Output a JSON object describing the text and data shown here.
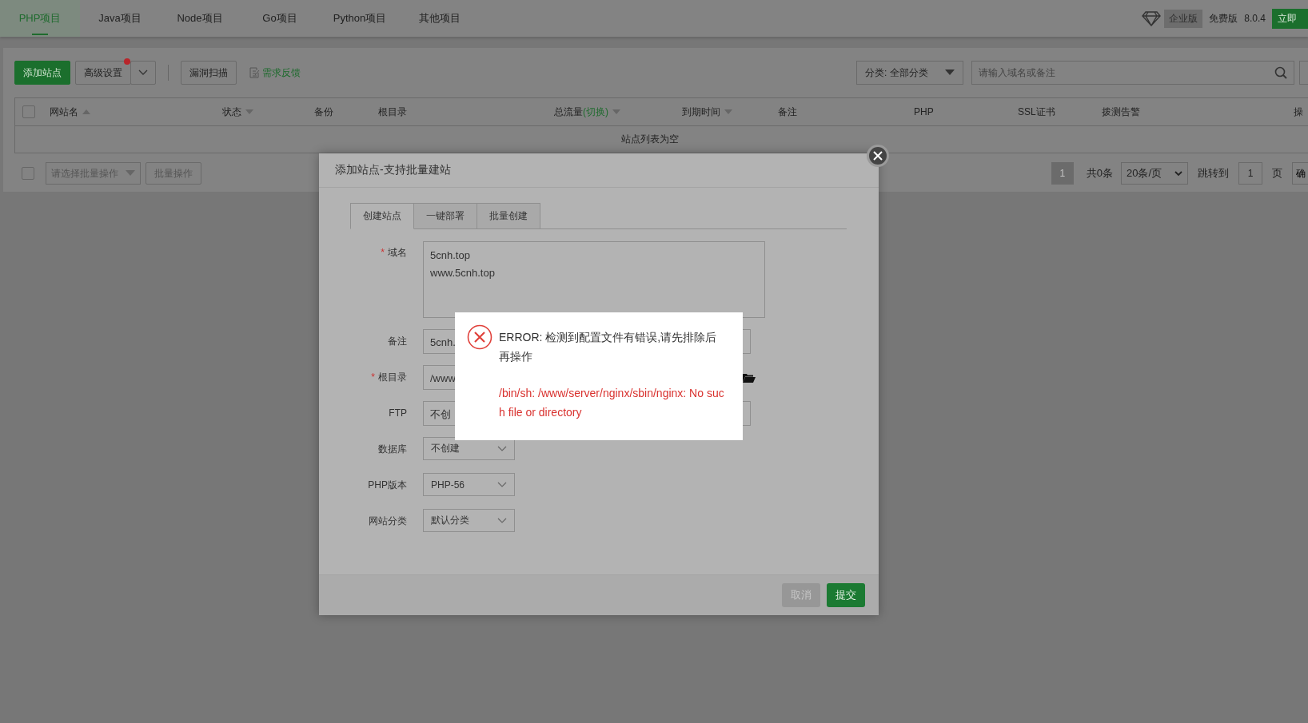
{
  "top_tabs": [
    {
      "label": "PHP项目",
      "selected": true
    },
    {
      "label": "Java项目",
      "selected": false
    },
    {
      "label": "Node项目",
      "selected": false
    },
    {
      "label": "Go项目",
      "selected": false
    },
    {
      "label": "Python项目",
      "selected": false
    },
    {
      "label": "其他项目",
      "selected": false
    }
  ],
  "edition": {
    "badge": "企业版",
    "plan": "免费版",
    "version": "8.0.4",
    "upgrade": "立即"
  },
  "toolbar": {
    "add": "添加站点",
    "advanced": "高级设置",
    "advanced_notice": true,
    "scan": "漏洞扫描",
    "feedback": "需求反馈",
    "category": "分类: 全部分类",
    "search": {
      "placeholder": "请输入域名或备注"
    }
  },
  "table": {
    "checked": false,
    "columns": [
      {
        "label": "网站名",
        "sortable": true,
        "ascending": true
      },
      {
        "label": "状态",
        "sortable": true,
        "ascending": false
      },
      {
        "label": "备份",
        "sortable": false
      },
      {
        "label": "根目录",
        "sortable": false
      },
      {
        "label": "总流量",
        "link": "(切换)",
        "sortable": true,
        "ascending": false
      },
      {
        "label": "到期时间",
        "sortable": true,
        "ascending": false
      },
      {
        "label": "备注",
        "sortable": false
      },
      {
        "label": "PHP",
        "sortable": false
      },
      {
        "label": "SSL证书",
        "sortable": false
      },
      {
        "label": "拨测告警",
        "sortable": false
      },
      {
        "label": "操",
        "sortable": false
      }
    ],
    "empty_text": "站点列表为空"
  },
  "batch": {
    "checked": false,
    "placeholder": "请选择批量操作",
    "button": "批量操作"
  },
  "pagination": {
    "current": "1",
    "total": "共0条",
    "page_size": "20条/页",
    "jump_label": "跳转到",
    "jump_value": "1",
    "page_unit": "页",
    "confirm": "确"
  },
  "dialog": {
    "title": "添加站点-支持批量建站",
    "tabs": [
      {
        "label": "创建站点",
        "selected": true
      },
      {
        "label": "一键部署",
        "selected": false
      },
      {
        "label": "批量创建",
        "selected": false
      }
    ],
    "fields": [
      {
        "label": "域名",
        "required_mark": "*",
        "kind": "textarea",
        "value": "5cnh.top\nwww.5cnh.top"
      },
      {
        "label": "备注",
        "kind": "input",
        "value": "5cnh."
      },
      {
        "label": "根目录",
        "required_mark": "*",
        "kind": "path",
        "value": "/www"
      },
      {
        "label": "FTP",
        "kind": "input",
        "value": "不创"
      },
      {
        "label": "数据库",
        "kind": "select",
        "value": "不创建"
      },
      {
        "label": "PHP版本",
        "kind": "select",
        "value": "PHP-56"
      },
      {
        "label": "网站分类",
        "kind": "select",
        "value": "默认分类"
      }
    ],
    "cancel": {
      "label": "取消",
      "disabled": true
    },
    "submit": "提交"
  },
  "error": {
    "message": "ERROR: 检测到配置文件有错误,请先排除后再操作",
    "detail": "/bin/sh: /www/server/nginx/sbin/nginx: No such file or directory"
  }
}
